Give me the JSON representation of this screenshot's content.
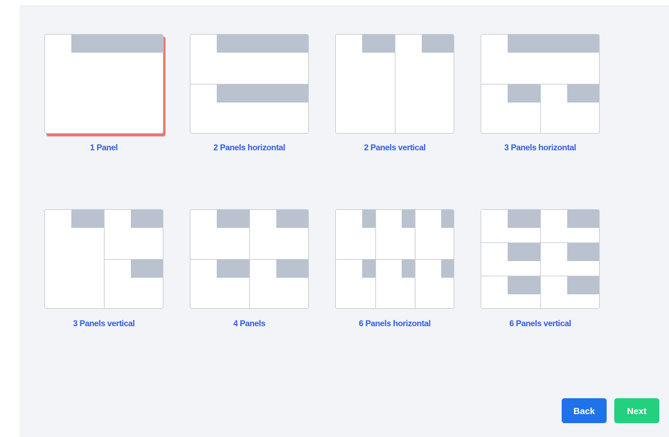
{
  "layouts": [
    {
      "label": "1 Panel",
      "selected": true
    },
    {
      "label": "2 Panels horizontal",
      "selected": false
    },
    {
      "label": "2 Panels vertical",
      "selected": false
    },
    {
      "label": "3 Panels horizontal",
      "selected": false
    },
    {
      "label": "3 Panels vertical",
      "selected": false
    },
    {
      "label": "4 Panels",
      "selected": false
    },
    {
      "label": "6 Panels horizontal",
      "selected": false
    },
    {
      "label": "6 Panels vertical",
      "selected": false
    }
  ],
  "buttons": {
    "back_label": "Back",
    "next_label": "Next"
  },
  "colors": {
    "label": "#2f5be0",
    "selected_accent": "#e8796b",
    "back_button": "#1f73ea",
    "next_button": "#22d07e",
    "placeholder_bar": "#b9c2ce",
    "background": "#f3f4f8"
  }
}
